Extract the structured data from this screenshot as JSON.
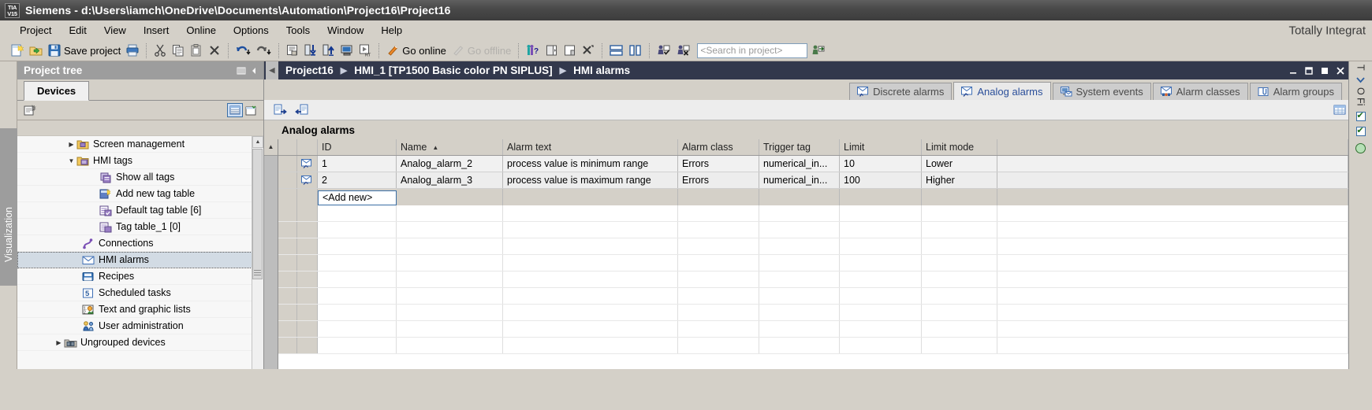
{
  "window": {
    "logo_line1": "TIA",
    "logo_line2": "V15",
    "title": "Siemens  -  d:\\Users\\iamch\\OneDrive\\Documents\\Automation\\Project16\\Project16",
    "brand": "Totally Integrat"
  },
  "menu": {
    "items": [
      {
        "label": "Project"
      },
      {
        "label": "Edit"
      },
      {
        "label": "View"
      },
      {
        "label": "Insert"
      },
      {
        "label": "Online"
      },
      {
        "label": "Options"
      },
      {
        "label": "Tools"
      },
      {
        "label": "Window"
      },
      {
        "label": "Help"
      }
    ]
  },
  "toolbar": {
    "new_project_icon": "new-project-icon",
    "open_project_icon": "open-project-icon",
    "save_icon": "save-icon",
    "save_label": "Save project",
    "print_icon": "print-icon",
    "cut_icon": "cut-icon",
    "copy_icon": "copy-icon",
    "paste_icon": "paste-icon",
    "delete_icon": "delete-icon",
    "undo_icon": "undo-icon",
    "redo_icon": "redo-icon",
    "compile_icon": "compile-icon",
    "download_icon": "download-to-device-icon",
    "upload_icon": "upload-from-device-icon",
    "start_sim_icon": "start-simulation-icon",
    "rt_icon": "start-runtime-icon",
    "go_online_icon": "go-online-icon",
    "go_online_label": "Go online",
    "go_offline_icon": "go-offline-icon",
    "go_offline_label": "Go offline",
    "help_icon": "online-help-icon",
    "show_hide_left_icon": "show-hide-left-pane-icon",
    "show_hide_right_icon": "show-hide-right-pane-icon",
    "close_all_icon": "close-all-editors-icon",
    "split_horizontal_icon": "split-editor-horizontal-icon",
    "split_vertical_icon": "split-editor-vertical-icon",
    "search_next_icon": "search-next-icon",
    "search_cancel_icon": "search-cancel-icon",
    "search_placeholder": "<Search in project>",
    "search_value": "<Search in project>",
    "search_go_icon": "search-go-icon"
  },
  "vstrip": {
    "label": "Visualization"
  },
  "tree": {
    "title": "Project tree",
    "pin_icon": "pin-icon",
    "collapse_icon": "collapse-pane-icon",
    "tab_label": "Devices",
    "toolbar_icon": "tree-options-icon",
    "view_detail_icon": "detail-view-icon",
    "view_compare_icon": "compare-view-icon",
    "items": [
      {
        "label": "Screen management",
        "arrow": "collapsed",
        "icon": "screen-management-icon",
        "indent": 1,
        "selected": false
      },
      {
        "label": "HMI tags",
        "arrow": "expanded",
        "icon": "hmi-tags-folder-icon",
        "indent": 1,
        "selected": false
      },
      {
        "label": "Show all tags",
        "arrow": "none",
        "icon": "show-all-tags-icon",
        "indent": 2,
        "selected": false
      },
      {
        "label": "Add new tag table",
        "arrow": "none",
        "icon": "add-new-tag-table-icon",
        "indent": 2,
        "selected": false
      },
      {
        "label": "Default tag table [6]",
        "arrow": "none",
        "icon": "tag-table-icon",
        "indent": 2,
        "selected": false
      },
      {
        "label": "Tag table_1 [0]",
        "arrow": "none",
        "icon": "tag-table-icon",
        "indent": 2,
        "selected": false
      },
      {
        "label": "Connections",
        "arrow": "none",
        "icon": "connections-icon",
        "indent": 1,
        "selected": false
      },
      {
        "label": "HMI alarms",
        "arrow": "none",
        "icon": "hmi-alarms-icon",
        "indent": 1,
        "selected": true
      },
      {
        "label": "Recipes",
        "arrow": "none",
        "icon": "recipes-icon",
        "indent": 1,
        "selected": false
      },
      {
        "label": "Scheduled tasks",
        "arrow": "none",
        "icon": "scheduled-tasks-icon",
        "indent": 1,
        "selected": false
      },
      {
        "label": "Text and graphic lists",
        "arrow": "none",
        "icon": "text-graphic-lists-icon",
        "indent": 1,
        "selected": false
      },
      {
        "label": "User administration",
        "arrow": "none",
        "icon": "user-administration-icon",
        "indent": 1,
        "selected": false
      },
      {
        "label": "Ungrouped devices",
        "arrow": "collapsed",
        "icon": "ungrouped-devices-icon",
        "indent": 0,
        "selected": false
      }
    ]
  },
  "editor": {
    "breadcrumb": [
      {
        "label": "Project16"
      },
      {
        "label": "HMI_1 [TP1500 Basic color PN SIPLUS]"
      },
      {
        "label": "HMI alarms"
      }
    ],
    "breadcrumb_separator": "▶",
    "collapse_icon": "collapse-editor-icon",
    "minimize_icon": "minimize-icon",
    "maximize_icon": "maximize-icon",
    "restore_icon": "restore-icon",
    "close_icon": "close-icon",
    "tabs": [
      {
        "label": "Discrete alarms",
        "icon": "discrete-alarms-icon",
        "active": false
      },
      {
        "label": "Analog alarms",
        "icon": "analog-alarms-icon",
        "active": true
      },
      {
        "label": "System events",
        "icon": "system-events-icon",
        "active": false
      },
      {
        "label": "Alarm classes",
        "icon": "alarm-classes-icon",
        "active": false
      },
      {
        "label": "Alarm groups",
        "icon": "alarm-groups-icon",
        "active": false
      }
    ],
    "toolbar": {
      "export_icon": "export-icon",
      "import_icon": "import-icon",
      "table_settings_icon": "table-settings-icon"
    },
    "caption": "Analog alarms"
  },
  "table": {
    "scroll_up_icon": "scroll-up-icon",
    "columns": [
      {
        "key": "id",
        "label": "ID",
        "sorted": false
      },
      {
        "key": "name",
        "label": "Name",
        "sorted": true,
        "sort_dir": "▲"
      },
      {
        "key": "text",
        "label": "Alarm text",
        "sorted": false
      },
      {
        "key": "cls",
        "label": "Alarm class",
        "sorted": false
      },
      {
        "key": "trig",
        "label": "Trigger tag",
        "sorted": false
      },
      {
        "key": "lim",
        "label": "Limit",
        "sorted": false
      },
      {
        "key": "mode",
        "label": "Limit mode",
        "sorted": false
      }
    ],
    "rows": [
      {
        "row_icon": "analog-alarm-row-icon",
        "id": "1",
        "name": "Analog_alarm_2",
        "text": "process value is minimum range",
        "cls": "Errors",
        "trig": "numerical_in...",
        "lim": "10",
        "mode": "Lower"
      },
      {
        "row_icon": "analog-alarm-row-icon",
        "id": "2",
        "name": "Analog_alarm_3",
        "text": "process value is maximum range",
        "cls": "Errors",
        "trig": "numerical_in...",
        "lim": "100",
        "mode": "Higher"
      }
    ],
    "add_new_label": "<Add new>"
  },
  "rightdock": {
    "title": "T",
    "option_label": "O",
    "filter_label": "Fi",
    "chevron_icon": "chevron-down-icon",
    "check_icon": "checkbox-checked-icon",
    "status_icon": "status-ok-icon"
  },
  "colors": {
    "titlebar": "#4a4a4a",
    "chrome": "#d4d0c8",
    "editor_header": "#32384c",
    "accent_blue": "#2b4f9a",
    "tree_selected": "#d2dbe4"
  }
}
